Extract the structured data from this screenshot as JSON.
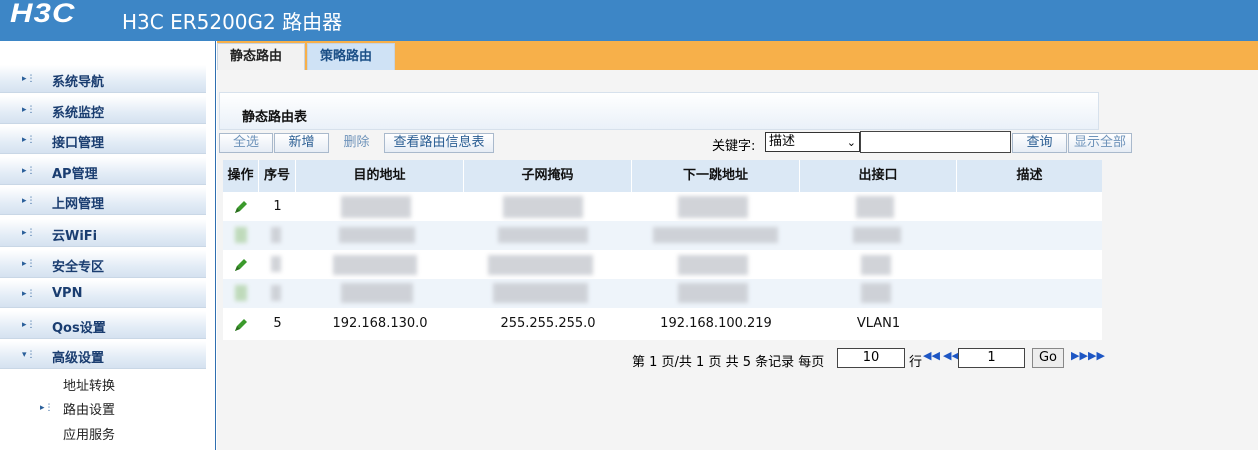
{
  "header": {
    "logo": "H3C",
    "title": "H3C ER5200G2 路由器"
  },
  "sidebar": {
    "items": [
      {
        "label": "系统导航"
      },
      {
        "label": "系统监控"
      },
      {
        "label": "接口管理"
      },
      {
        "label": "AP管理"
      },
      {
        "label": "上网管理"
      },
      {
        "label": "云WiFi"
      },
      {
        "label": "安全专区"
      },
      {
        "label": "VPN"
      },
      {
        "label": "Qos设置"
      },
      {
        "label": "高级设置"
      }
    ],
    "subitems": [
      {
        "label": "地址转换"
      },
      {
        "label": "路由设置"
      },
      {
        "label": "应用服务"
      }
    ]
  },
  "tabs": [
    {
      "label": "静态路由"
    },
    {
      "label": "策略路由"
    }
  ],
  "panel": {
    "title": "静态路由表"
  },
  "toolbar": {
    "select_all": "全选",
    "add": "新增",
    "delete": "删除",
    "view_table": "查看路由信息表",
    "keyword_label": "关键字:",
    "keyword_select": "描述",
    "search": "查询",
    "show_all": "显示全部"
  },
  "table": {
    "headers": [
      "操作",
      "序号",
      "目的地址",
      "子网掩码",
      "下一跳地址",
      "出接口",
      "描述"
    ],
    "rows": [
      {
        "index": "1",
        "dest": "",
        "mask": "",
        "nexthop": "",
        "iface": "",
        "desc": ""
      },
      {
        "index": "",
        "dest": "",
        "mask": "",
        "nexthop": "",
        "iface": "",
        "desc": ""
      },
      {
        "index": "",
        "dest": "",
        "mask": "",
        "nexthop": "",
        "iface": "",
        "desc": ""
      },
      {
        "index": "",
        "dest": "",
        "mask": "",
        "nexthop": "",
        "iface": "",
        "desc": ""
      },
      {
        "index": "5",
        "dest": "192.168.130.0",
        "mask": "255.255.255.0",
        "nexthop": "192.168.100.219",
        "iface": "VLAN1",
        "desc": ""
      }
    ]
  },
  "pager": {
    "summary": "第 1 页/共 1 页 共 5 条记录 每页",
    "per_page": "10",
    "row_label": "行",
    "page": "1",
    "go": "Go"
  },
  "colors": {
    "header": "#3d86c6",
    "tabstrip": "#f7b04a",
    "link": "#2b5e93"
  }
}
